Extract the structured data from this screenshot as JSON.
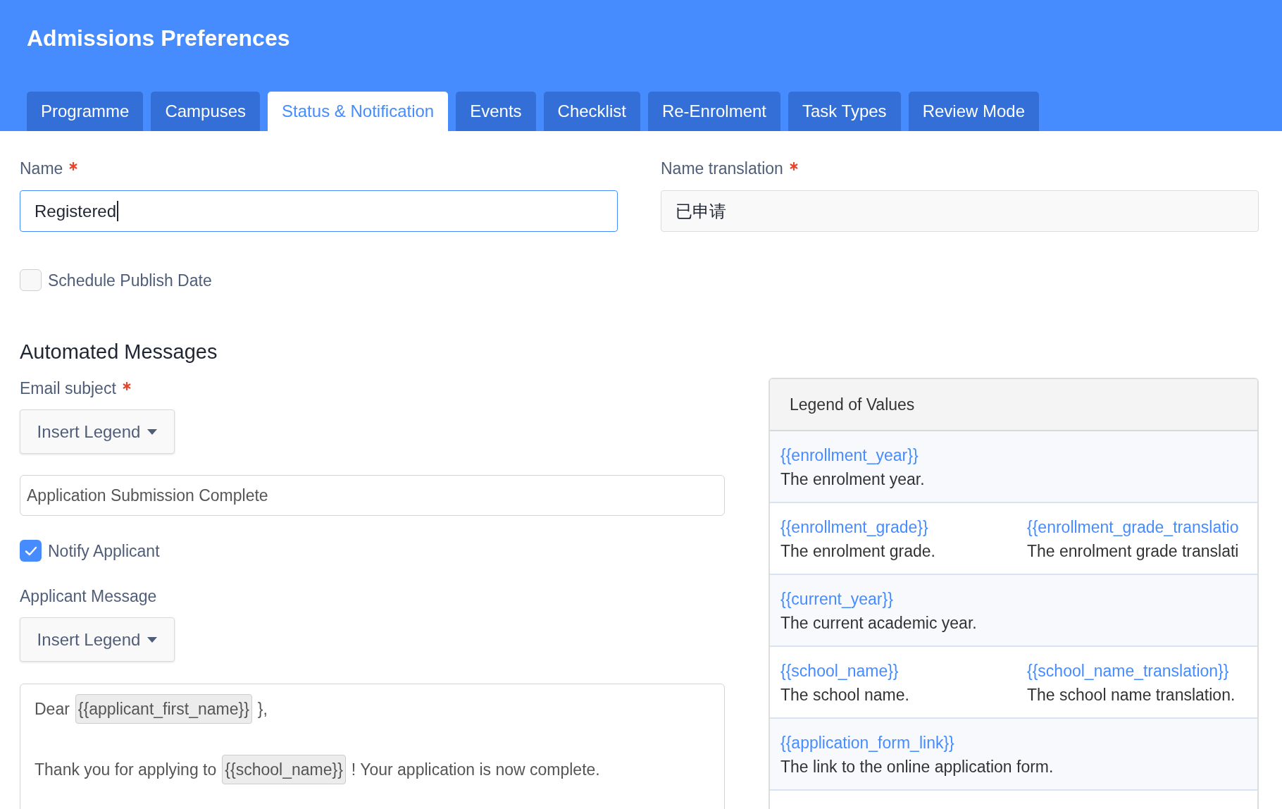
{
  "header": {
    "title": "Admissions Preferences"
  },
  "tabs": [
    {
      "label": "Programme",
      "selected": false
    },
    {
      "label": "Campuses",
      "selected": false
    },
    {
      "label": "Status & Notification",
      "selected": true
    },
    {
      "label": "Events",
      "selected": false
    },
    {
      "label": "Checklist",
      "selected": false
    },
    {
      "label": "Re-Enrolment",
      "selected": false
    },
    {
      "label": "Task Types",
      "selected": false
    },
    {
      "label": "Review Mode",
      "selected": false
    }
  ],
  "fields": [
    {
      "label": "Name",
      "required": true,
      "value": "Registered",
      "focused": true
    },
    {
      "label": "Name translation",
      "required": true,
      "value": "已申请",
      "focused": false
    }
  ],
  "schedule_publish_date": {
    "label": "Schedule Publish Date",
    "checked": false
  },
  "automated_messages": {
    "heading": "Automated Messages",
    "email_subject": {
      "label": "Email subject",
      "required": true,
      "insert_button": "Insert Legend",
      "value": "Application Submission Complete"
    },
    "notify_applicant": {
      "label": "Notify Applicant",
      "checked": true
    },
    "applicant_message": {
      "label": "Applicant Message",
      "required": false,
      "insert_button": "Insert Legend",
      "lines": [
        [
          {
            "kind": "text",
            "text": "Dear"
          },
          {
            "kind": "token",
            "text": "{{applicant_first_name}}"
          },
          {
            "kind": "text",
            "text": "},"
          }
        ],
        [
          {
            "kind": "text",
            "text": "Thank you for applying to"
          },
          {
            "kind": "token",
            "text": "{{school_name}}"
          },
          {
            "kind": "text",
            "text": "! Your application is now complete."
          }
        ]
      ]
    }
  },
  "legend": {
    "title": "Legend of Values",
    "rows": [
      {
        "entries": [
          {
            "key": "{{enrollment_year}}",
            "description": "The enrolment year."
          }
        ]
      },
      {
        "entries": [
          {
            "key": "{{enrollment_grade}}",
            "description": "The enrolment grade."
          },
          {
            "key": "{{enrollment_grade_translatio",
            "description": "The enrolment grade translati"
          }
        ]
      },
      {
        "entries": [
          {
            "key": "{{current_year}}",
            "description": "The current academic year."
          }
        ]
      },
      {
        "entries": [
          {
            "key": "{{school_name}}",
            "description": "The school name."
          },
          {
            "key": "{{school_name_translation}}",
            "description": "The school name translation."
          }
        ]
      },
      {
        "entries": [
          {
            "key": "{{application_form_link}}",
            "description": "The link to the online application form."
          }
        ]
      }
    ]
  }
}
